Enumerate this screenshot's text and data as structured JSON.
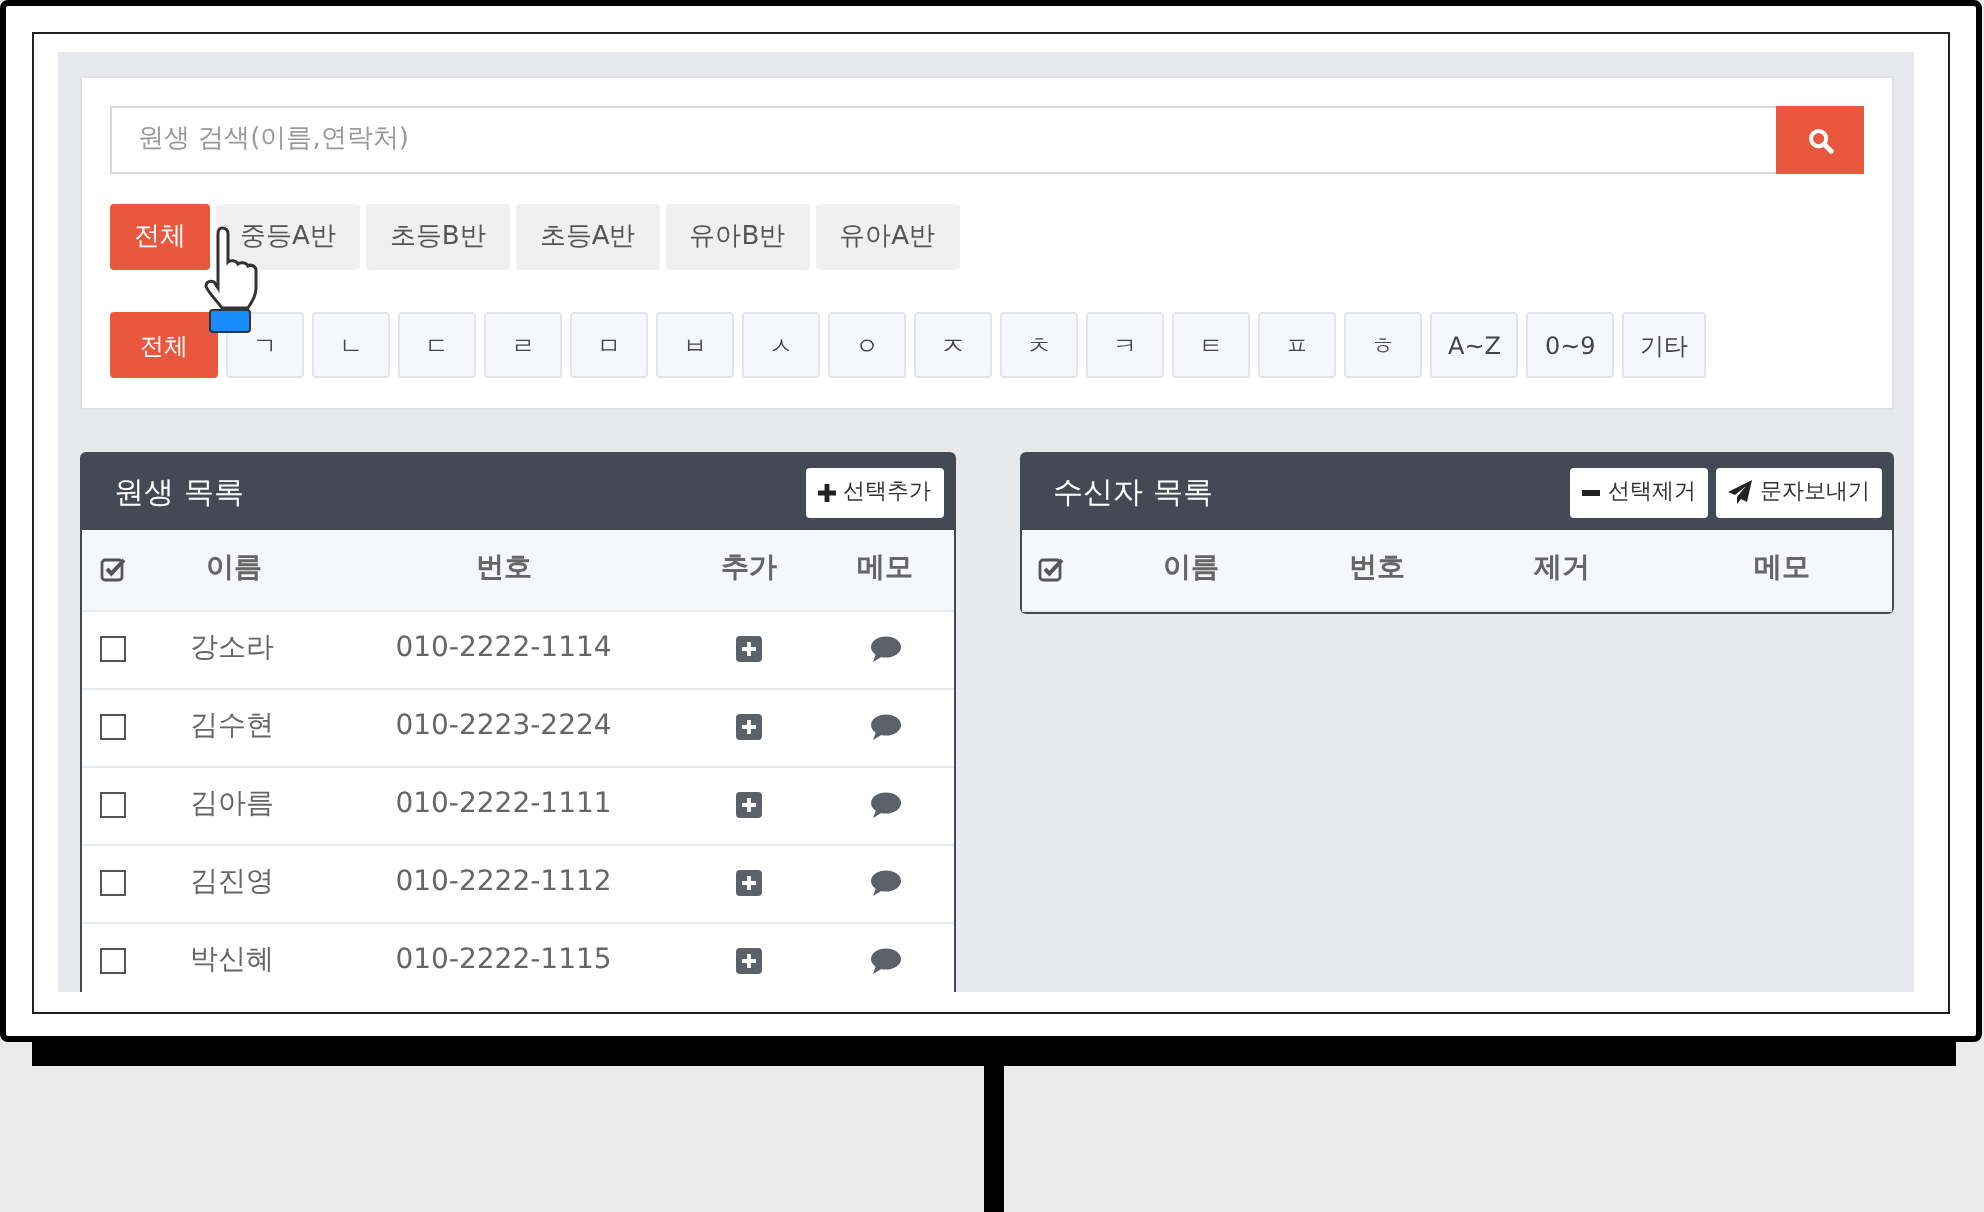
{
  "search": {
    "placeholder": "원생 검색(이름,연락처)"
  },
  "class_filters": [
    {
      "label": "전체",
      "selected": true
    },
    {
      "label": "중등A반",
      "selected": false
    },
    {
      "label": "초등B반",
      "selected": false
    },
    {
      "label": "초등A반",
      "selected": false
    },
    {
      "label": "유아B반",
      "selected": false
    },
    {
      "label": "유아A반",
      "selected": false
    }
  ],
  "letter_filters": [
    {
      "label": "전체",
      "selected": true
    },
    {
      "label": "ㄱ",
      "selected": false
    },
    {
      "label": "ㄴ",
      "selected": false
    },
    {
      "label": "ㄷ",
      "selected": false
    },
    {
      "label": "ㄹ",
      "selected": false
    },
    {
      "label": "ㅁ",
      "selected": false
    },
    {
      "label": "ㅂ",
      "selected": false
    },
    {
      "label": "ㅅ",
      "selected": false
    },
    {
      "label": "ㅇ",
      "selected": false
    },
    {
      "label": "ㅈ",
      "selected": false
    },
    {
      "label": "ㅊ",
      "selected": false
    },
    {
      "label": "ㅋ",
      "selected": false
    },
    {
      "label": "ㅌ",
      "selected": false
    },
    {
      "label": "ㅍ",
      "selected": false
    },
    {
      "label": "ㅎ",
      "selected": false
    },
    {
      "label": "A~Z",
      "selected": false
    },
    {
      "label": "0~9",
      "selected": false
    },
    {
      "label": "기타",
      "selected": false
    }
  ],
  "student_list": {
    "title": "원생 목록",
    "buttons": [
      {
        "kind": "add",
        "label": "선택추가"
      }
    ],
    "columns": [
      "이름",
      "번호",
      "추가",
      "메모"
    ],
    "rows": [
      {
        "checked": false,
        "name": "강소라",
        "phone": "010-2222-1114"
      },
      {
        "checked": false,
        "name": "김수현",
        "phone": "010-2223-2224"
      },
      {
        "checked": false,
        "name": "김아름",
        "phone": "010-2222-1111"
      },
      {
        "checked": false,
        "name": "김진영",
        "phone": "010-2222-1112"
      },
      {
        "checked": false,
        "name": "박신혜",
        "phone": "010-2222-1115"
      }
    ]
  },
  "recipient_list": {
    "title": "수신자 목록",
    "buttons": [
      {
        "kind": "remove",
        "label": "선택제거"
      },
      {
        "kind": "send",
        "label": "문자보내기"
      }
    ],
    "columns": [
      "이름",
      "번호",
      "제거",
      "메모"
    ]
  }
}
